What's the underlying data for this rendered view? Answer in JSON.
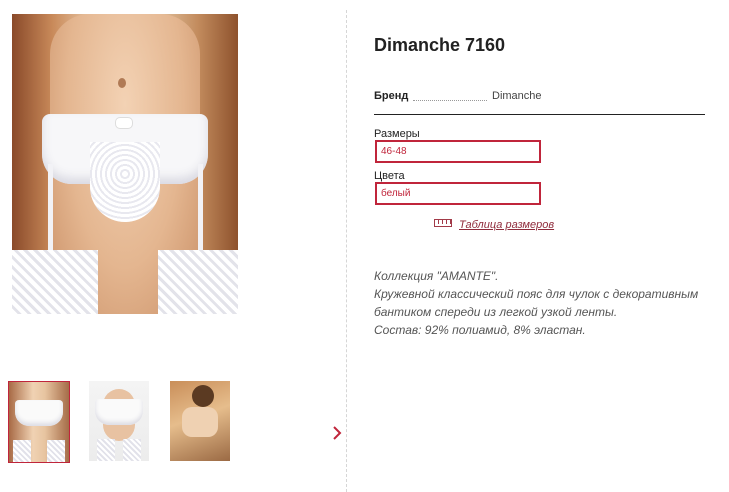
{
  "product": {
    "title": "Dimanche 7160",
    "brand_label": "Бренд",
    "brand_value": "Dimanche"
  },
  "options": {
    "sizes_label": "Размеры",
    "sizes_value": "46-48",
    "colors_label": "Цвета",
    "colors_value": "белый"
  },
  "size_table_link": "Таблица размеров",
  "description": [
    "Коллекция \"AMANTE\".",
    "Кружевной классический пояс для чулок с декоративным",
    "бантиком спереди из легкой узкой ленты.",
    "Состав: 92% полиамид, 8% эластан."
  ],
  "gallery": {
    "next_icon": "chevron-right-icon",
    "active_index": 0
  },
  "colors": {
    "accent": "#c0253b",
    "link": "#8f2a3a"
  }
}
